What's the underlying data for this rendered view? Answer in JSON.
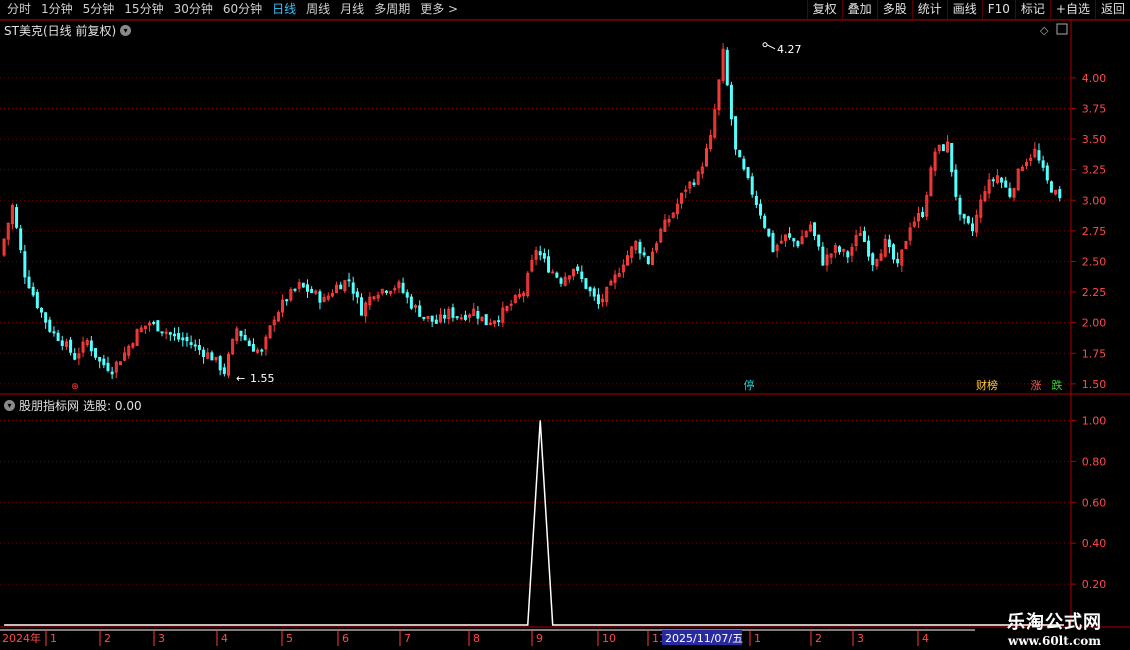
{
  "toolbar": {
    "periods": [
      "分时",
      "1分钟",
      "5分钟",
      "15分钟",
      "30分钟",
      "60分钟",
      "日线",
      "周线",
      "月线",
      "多周期",
      "更多 >"
    ],
    "active_period": "日线",
    "actions": [
      "复权",
      "叠加",
      "多股",
      "统计",
      "画线",
      "F10",
      "标记",
      "+自选",
      "返回"
    ]
  },
  "main_panel": {
    "title": "ST美克(日线 前复权)",
    "y_ticks": [
      "4.00",
      "3.75",
      "3.50",
      "3.25",
      "3.00",
      "2.75",
      "2.50",
      "2.25",
      "2.00",
      "1.75",
      "1.50"
    ],
    "high_label": "4.27",
    "low_label": "1.55",
    "markers": [
      {
        "text": "停",
        "color": "#29c6c6"
      },
      {
        "text": "财榜",
        "color": "#ffcc33"
      },
      {
        "text": "涨",
        "color": "#ff5a5a"
      },
      {
        "text": "跌",
        "color": "#33dd33"
      }
    ]
  },
  "indicator_panel": {
    "title": "股朋指标网",
    "value_label": "选股: 0.00",
    "y_ticks": [
      "1.00",
      "0.80",
      "0.60",
      "0.40",
      "0.20"
    ]
  },
  "x_axis": {
    "year_label": "2024年",
    "months": [
      "1",
      "2",
      "3",
      "4",
      "5",
      "6",
      "7",
      "8",
      "9",
      "10",
      "11",
      "1",
      "2",
      "3",
      "4"
    ],
    "cursor_date": "2025/11/07/五"
  },
  "watermark": {
    "line1": "乐淘公式网",
    "line2": "www.60lt.com"
  },
  "colors": {
    "up": "#ff3c3c",
    "down": "#54ffff",
    "axis": "#b00000",
    "grid": "#7a0000",
    "highlight": "#2a2aa0"
  },
  "chart_data": {
    "type": "candlestick",
    "price_close_trend": [
      2.55,
      2.95,
      2.4,
      2.15,
      1.95,
      1.85,
      1.72,
      1.85,
      1.68,
      1.62,
      1.75,
      1.92,
      2.0,
      1.95,
      1.88,
      1.85,
      1.78,
      1.72,
      1.6,
      1.95,
      1.82,
      1.75,
      2.05,
      2.2,
      2.3,
      2.25,
      2.18,
      2.3,
      2.35,
      2.1,
      2.25,
      2.28,
      2.3,
      2.15,
      2.05,
      2.0,
      2.08,
      2.05,
      2.1,
      2.0,
      2.05,
      2.15,
      2.25,
      2.6,
      2.45,
      2.35,
      2.45,
      2.3,
      2.15,
      2.3,
      2.5,
      2.65,
      2.5,
      2.75,
      2.9,
      3.1,
      3.2,
      3.5,
      4.2,
      3.4,
      3.15,
      2.9,
      2.6,
      2.7,
      2.65,
      2.8,
      2.5,
      2.6,
      2.55,
      2.75,
      2.5,
      2.65,
      2.45,
      2.8,
      2.9,
      3.4,
      3.45,
      2.85,
      2.75,
      3.1,
      3.2,
      3.05,
      3.3,
      3.4,
      3.15,
      3.0
    ],
    "indicator_values": [
      0,
      0,
      0,
      0,
      0,
      0,
      0,
      0,
      0,
      0,
      0,
      0,
      0,
      0,
      0,
      0,
      0,
      0,
      0,
      0,
      0,
      0,
      0,
      0,
      0,
      0,
      0,
      0,
      0,
      0,
      0,
      0,
      0,
      0,
      0,
      0,
      0,
      0,
      0,
      0,
      0,
      0,
      0,
      1,
      0,
      0,
      0,
      0,
      0,
      0,
      0,
      0,
      0,
      0,
      0,
      0,
      0,
      0,
      0,
      0,
      0,
      0,
      0,
      0,
      0,
      0,
      0,
      0,
      0,
      0,
      0,
      0,
      0,
      0,
      0,
      0,
      0,
      0,
      0,
      0,
      0,
      0,
      0,
      0,
      0,
      0
    ],
    "price_range": [
      1.45,
      4.35
    ],
    "indicator_range": [
      0,
      1.1
    ]
  }
}
